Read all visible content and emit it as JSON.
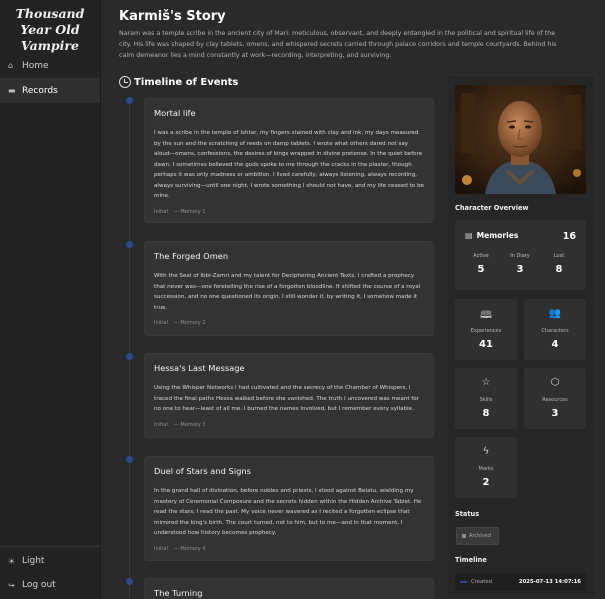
{
  "app": {
    "title": "Thousand Year Old Vampire"
  },
  "nav": {
    "items": [
      {
        "label": "Home",
        "icon": "home-icon"
      },
      {
        "label": "Records",
        "icon": "records-icon",
        "active": true
      }
    ],
    "bottom": [
      {
        "label": "Light",
        "icon": "sun-icon"
      },
      {
        "label": "Log out",
        "icon": "logout-icon"
      }
    ]
  },
  "page": {
    "title": "Karmiš's Story",
    "intro": "Naram was a temple scribe in the ancient city of Mari: meticulous, observant, and deeply entangled in the political and spiritual life of the city. His life was shaped by clay tablets, omens, and whispered secrets carried through palace corridors and temple courtyards. Behind his calm demeanor lies a mind constantly at work—recording, interpreting, and surviving."
  },
  "timeline": {
    "title": "Timeline of Events",
    "events": [
      {
        "title": "Mortal life",
        "text": "I was a scribe in the temple of Ishtar, my fingers stained with clay and ink, my days measured by the sun and the scratching of reeds on damp tablets. I wrote what others dared not say aloud—omens, confessions, the desires of kings wrapped in divine pretense. In the quiet before dawn, I sometimes believed the gods spoke to me through the cracks in the plaster, though perhaps it was only madness or ambition. I lived carefully, always listening, always recording, always surviving—until one night, I wrote something I should not have, and my life ceased to be mine.",
        "tag": "Initial",
        "memory": "— Memory 1"
      },
      {
        "title": "The Forged Omen",
        "text": "With the Seal of Ibbi-Zamri and my talent for Deciphering Ancient Texts, I crafted a prophecy that never was—one foretelling the rise of a forgotten bloodline. It shifted the course of a royal succession, and no one questioned its origin. I still wonder if, by writing it, I somehow made it true.",
        "tag": "Initial",
        "memory": "— Memory 2"
      },
      {
        "title": "Hessa's Last Message",
        "text": "Using the Whisper Networks I had cultivated and the secrecy of the Chamber of Whispers, I traced the final paths Hessa walked before she vanished. The truth I uncovered was meant for no one to hear—least of all me. I burned the names involved, but I remember every syllable.",
        "tag": "Initial",
        "memory": "— Memory 3"
      },
      {
        "title": "Duel of Stars and Signs",
        "text": "In the grand hall of divination, before nobles and priests, I stood against Belatu, wielding my mastery of Ceremonial Composure and the secrets hidden within the Hidden Archive Tablet. He read the stars; I read the past. My voice never wavered as I recited a forgotten eclipse that mirrored the king's birth. The court turned, not to him, but to me—and in that moment, I understood how history becomes prophecy.",
        "tag": "Initial",
        "memory": "— Memory 4"
      },
      {
        "title": "The Turning",
        "text": "",
        "tag": "",
        "memory": ""
      }
    ]
  },
  "panel": {
    "overview_title": "Character Overview",
    "memories": {
      "label": "Memories",
      "count": "16",
      "stats": [
        {
          "label": "Active",
          "value": "5"
        },
        {
          "label": "In Diary",
          "value": "3"
        },
        {
          "label": "Lost",
          "value": "8"
        }
      ]
    },
    "stats": [
      {
        "label": "Experiences",
        "value": "41",
        "icon": "book-icon"
      },
      {
        "label": "Characters",
        "value": "4",
        "icon": "people-icon"
      },
      {
        "label": "Skills",
        "value": "8",
        "icon": "star-icon"
      },
      {
        "label": "Resources",
        "value": "3",
        "icon": "cube-icon"
      },
      {
        "label": "Marks",
        "value": "2",
        "icon": "bolt-icon"
      }
    ],
    "status_title": "Status",
    "status_value": "Archived",
    "timeline_title": "Timeline",
    "timeline_items": [
      {
        "label": "Created",
        "date": "2025-07-13 14:07:16"
      }
    ]
  }
}
